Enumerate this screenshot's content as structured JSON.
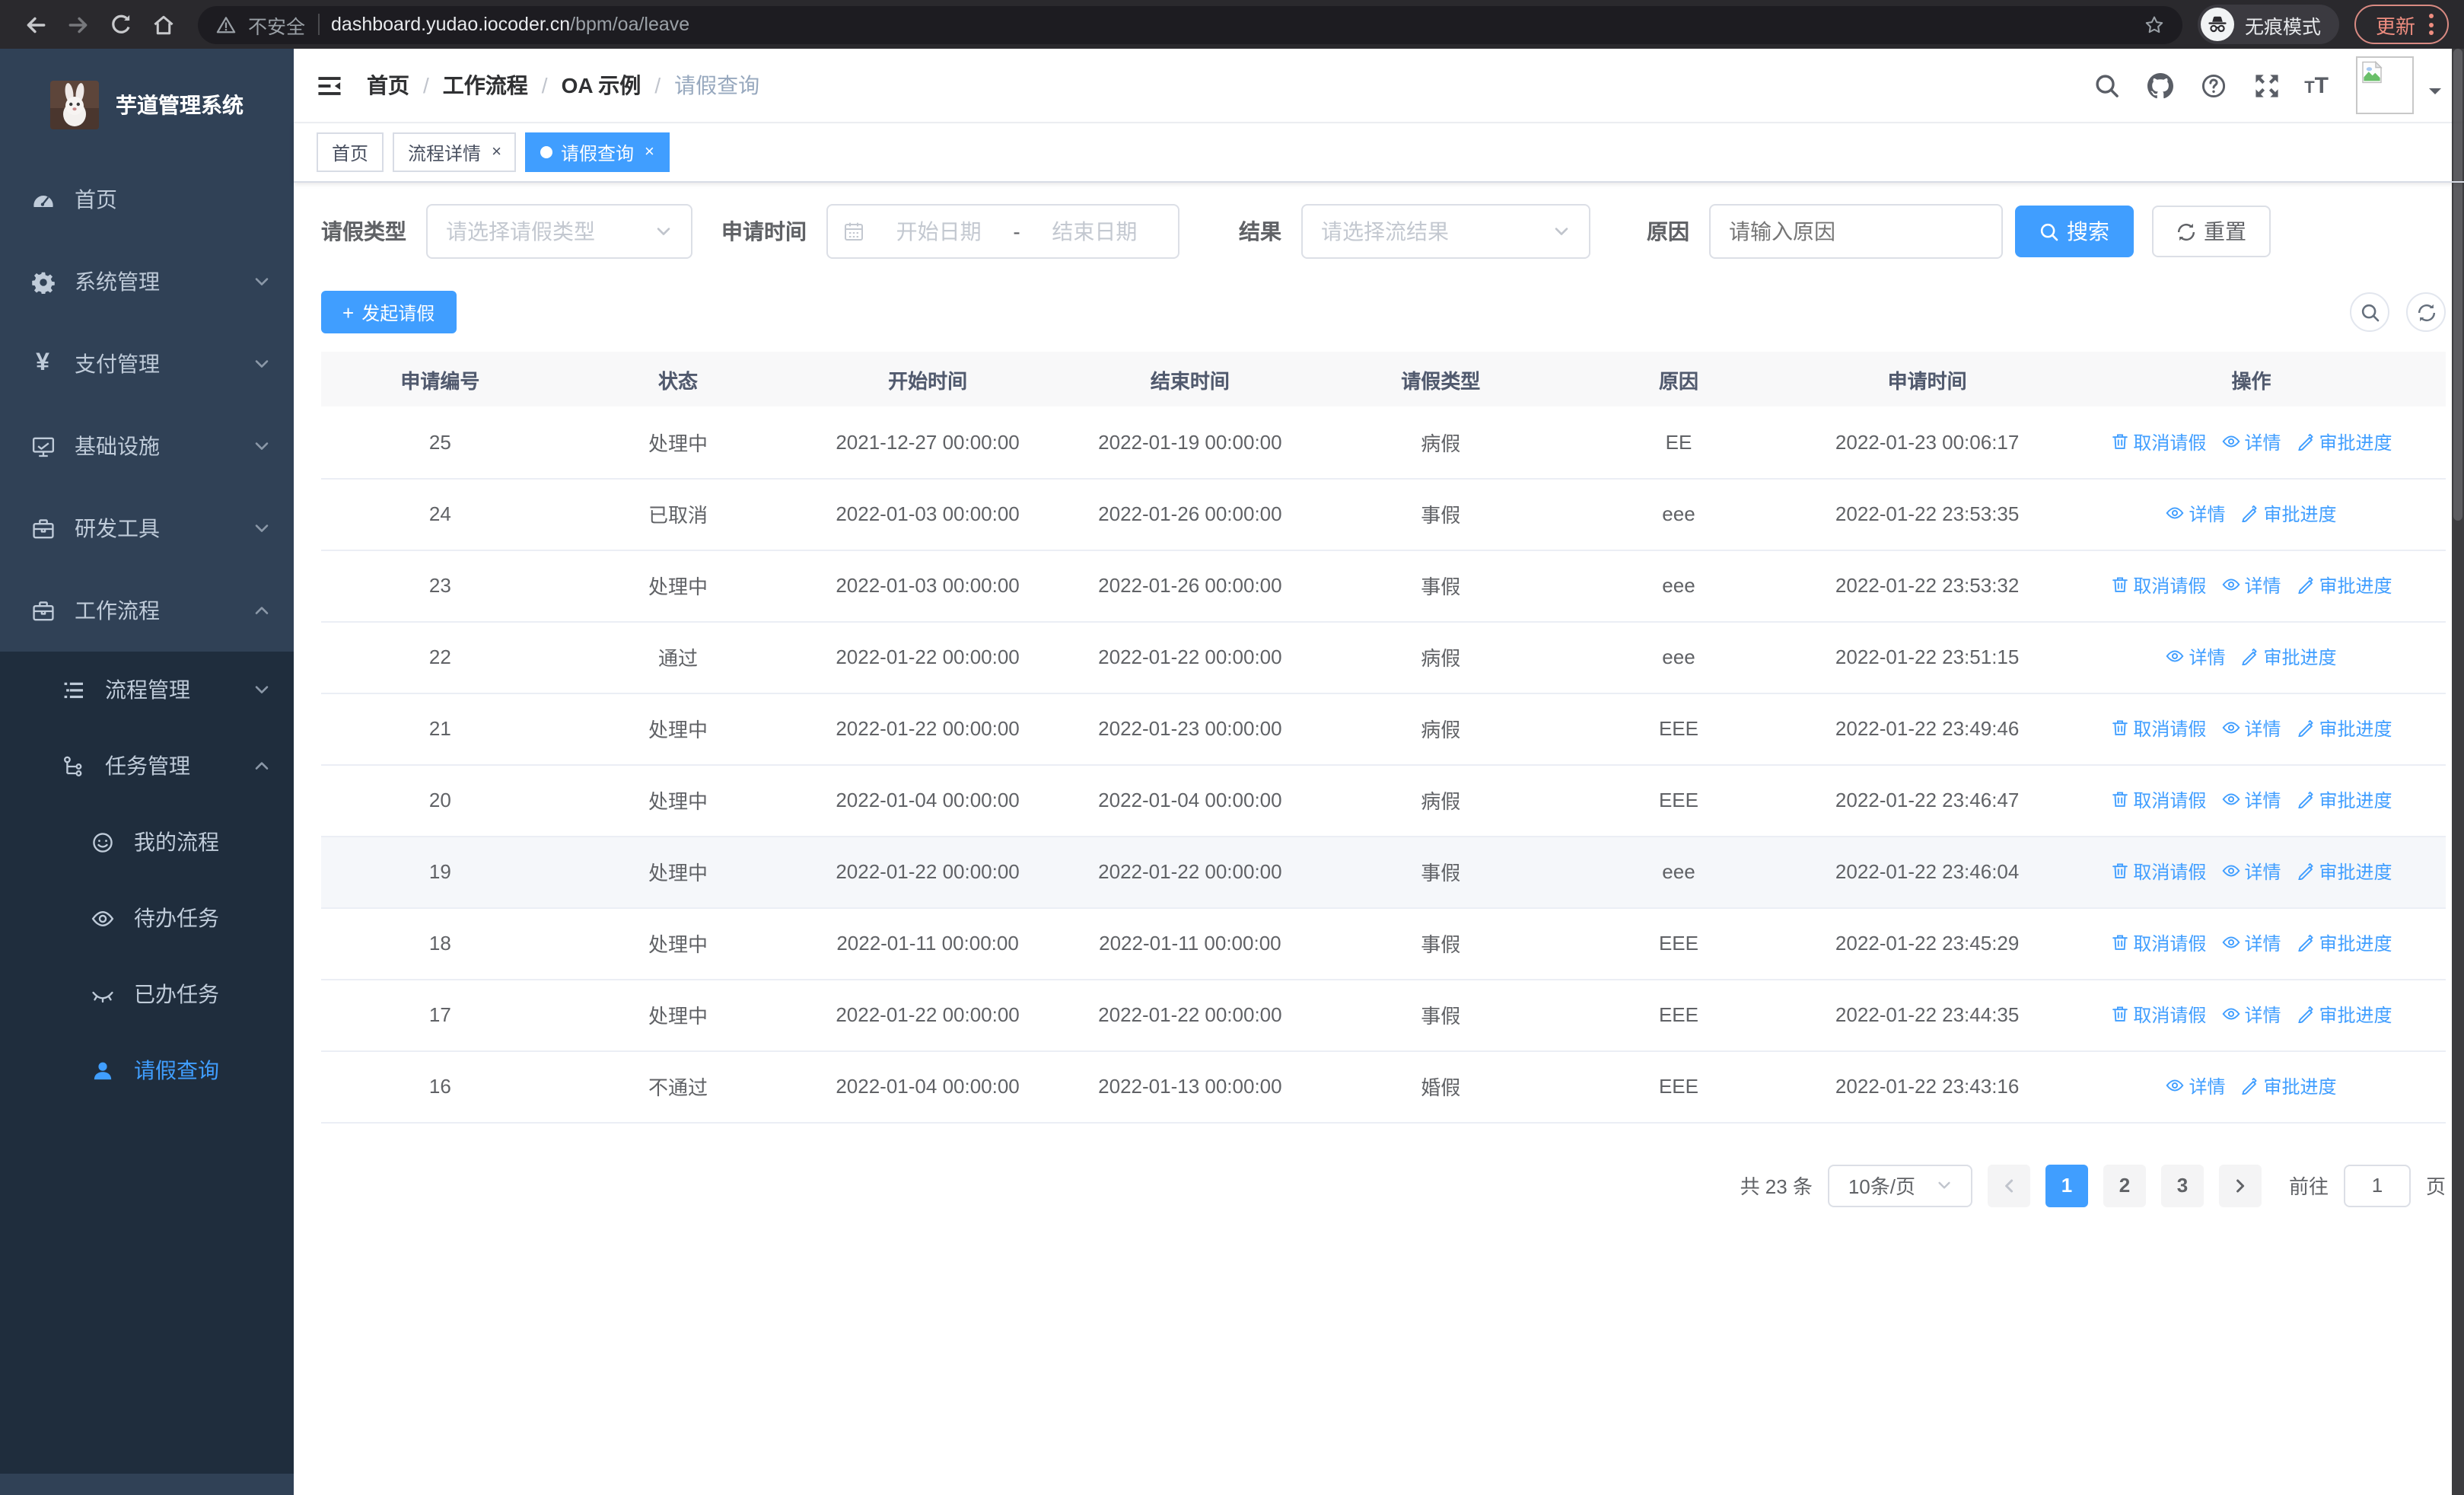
{
  "colors": {
    "accent": "#409eff",
    "sidebar_bg": "#304156",
    "submenu_bg": "#1f2d3d",
    "chrome_bg": "#2a292d",
    "update_red": "#ef8d80",
    "header_bg": "#f8f8f9",
    "highlight_row": "#f5f7fa"
  },
  "chrome": {
    "secure_label": "不安全",
    "host": "dashboard.yudao.iocoder.cn",
    "path": "/bpm/oa/leave",
    "incognito_label": "无痕模式",
    "update_label": "更新"
  },
  "sidebar": {
    "title": "芋道管理系统",
    "items": [
      {
        "label": "首页",
        "icon": "gauge",
        "level": 1
      },
      {
        "label": "系统管理",
        "icon": "gear",
        "level": 1,
        "chevron": "down"
      },
      {
        "label": "支付管理",
        "icon": "yen",
        "level": 1,
        "chevron": "down"
      },
      {
        "label": "基础设施",
        "icon": "monitor",
        "level": 1,
        "chevron": "down"
      },
      {
        "label": "研发工具",
        "icon": "toolbox",
        "level": 1,
        "chevron": "down"
      },
      {
        "label": "工作流程",
        "icon": "toolbox",
        "level": 1,
        "chevron": "up"
      },
      {
        "label": "流程管理",
        "icon": "flow-list",
        "level": 2,
        "sub": true,
        "chevron": "down"
      },
      {
        "label": "任务管理",
        "icon": "task-tree",
        "level": 2,
        "sub": true,
        "chevron": "up"
      },
      {
        "label": "我的流程",
        "icon": "face",
        "level": 3,
        "sub": true
      },
      {
        "label": "待办任务",
        "icon": "eye-open",
        "level": 3,
        "sub": true
      },
      {
        "label": "已办任务",
        "icon": "eye-closed",
        "level": 3,
        "sub": true
      },
      {
        "label": "请假查询",
        "icon": "user",
        "level": 3,
        "sub": true,
        "active": true
      }
    ]
  },
  "breadcrumb": [
    "首页",
    "工作流程",
    "OA 示例",
    "请假查询"
  ],
  "tabs": [
    {
      "label": "首页",
      "closable": false,
      "active": false
    },
    {
      "label": "流程详情",
      "closable": true,
      "active": false
    },
    {
      "label": "请假查询",
      "closable": true,
      "active": true
    }
  ],
  "filters": {
    "leave_type_label": "请假类型",
    "leave_type_placeholder": "请选择请假类型",
    "apply_time_label": "申请时间",
    "start_date_placeholder": "开始日期",
    "range_separator": "-",
    "end_date_placeholder": "结束日期",
    "result_label": "结果",
    "result_placeholder": "请选择流结果",
    "reason_label": "原因",
    "reason_placeholder": "请输入原因",
    "search_label": "搜索",
    "reset_label": "重置"
  },
  "toolbar": {
    "create_label": "发起请假"
  },
  "table": {
    "columns": [
      "申请编号",
      "状态",
      "开始时间",
      "结束时间",
      "请假类型",
      "原因",
      "申请时间",
      "操作"
    ],
    "action_labels": {
      "cancel": "取消请假",
      "detail": "详情",
      "progress": "审批进度"
    },
    "rows": [
      {
        "id": "25",
        "status": "处理中",
        "start": "2021-12-27 00:00:00",
        "end": "2022-01-19 00:00:00",
        "type": "病假",
        "reason": "EE",
        "applied": "2022-01-23 00:06:17",
        "actions": [
          "cancel",
          "detail",
          "progress"
        ],
        "highlight": false
      },
      {
        "id": "24",
        "status": "已取消",
        "start": "2022-01-03 00:00:00",
        "end": "2022-01-26 00:00:00",
        "type": "事假",
        "reason": "eee",
        "applied": "2022-01-22 23:53:35",
        "actions": [
          "detail",
          "progress"
        ],
        "highlight": false
      },
      {
        "id": "23",
        "status": "处理中",
        "start": "2022-01-03 00:00:00",
        "end": "2022-01-26 00:00:00",
        "type": "事假",
        "reason": "eee",
        "applied": "2022-01-22 23:53:32",
        "actions": [
          "cancel",
          "detail",
          "progress"
        ],
        "highlight": false
      },
      {
        "id": "22",
        "status": "通过",
        "start": "2022-01-22 00:00:00",
        "end": "2022-01-22 00:00:00",
        "type": "病假",
        "reason": "eee",
        "applied": "2022-01-22 23:51:15",
        "actions": [
          "detail",
          "progress"
        ],
        "highlight": false
      },
      {
        "id": "21",
        "status": "处理中",
        "start": "2022-01-22 00:00:00",
        "end": "2022-01-23 00:00:00",
        "type": "病假",
        "reason": "EEE",
        "applied": "2022-01-22 23:49:46",
        "actions": [
          "cancel",
          "detail",
          "progress"
        ],
        "highlight": false
      },
      {
        "id": "20",
        "status": "处理中",
        "start": "2022-01-04 00:00:00",
        "end": "2022-01-04 00:00:00",
        "type": "病假",
        "reason": "EEE",
        "applied": "2022-01-22 23:46:47",
        "actions": [
          "cancel",
          "detail",
          "progress"
        ],
        "highlight": false
      },
      {
        "id": "19",
        "status": "处理中",
        "start": "2022-01-22 00:00:00",
        "end": "2022-01-22 00:00:00",
        "type": "事假",
        "reason": "eee",
        "applied": "2022-01-22 23:46:04",
        "actions": [
          "cancel",
          "detail",
          "progress"
        ],
        "highlight": true
      },
      {
        "id": "18",
        "status": "处理中",
        "start": "2022-01-11 00:00:00",
        "end": "2022-01-11 00:00:00",
        "type": "事假",
        "reason": "EEE",
        "applied": "2022-01-22 23:45:29",
        "actions": [
          "cancel",
          "detail",
          "progress"
        ],
        "highlight": false
      },
      {
        "id": "17",
        "status": "处理中",
        "start": "2022-01-22 00:00:00",
        "end": "2022-01-22 00:00:00",
        "type": "事假",
        "reason": "EEE",
        "applied": "2022-01-22 23:44:35",
        "actions": [
          "cancel",
          "detail",
          "progress"
        ],
        "highlight": false
      },
      {
        "id": "16",
        "status": "不通过",
        "start": "2022-01-04 00:00:00",
        "end": "2022-01-13 00:00:00",
        "type": "婚假",
        "reason": "EEE",
        "applied": "2022-01-22 23:43:16",
        "actions": [
          "detail",
          "progress"
        ],
        "highlight": false
      }
    ]
  },
  "pagination": {
    "total_label": "共 23 条",
    "page_size": "10条/页",
    "pages": [
      "1",
      "2",
      "3"
    ],
    "current": "1",
    "goto_label": "前往",
    "goto_value": "1",
    "page_suffix": "页"
  }
}
